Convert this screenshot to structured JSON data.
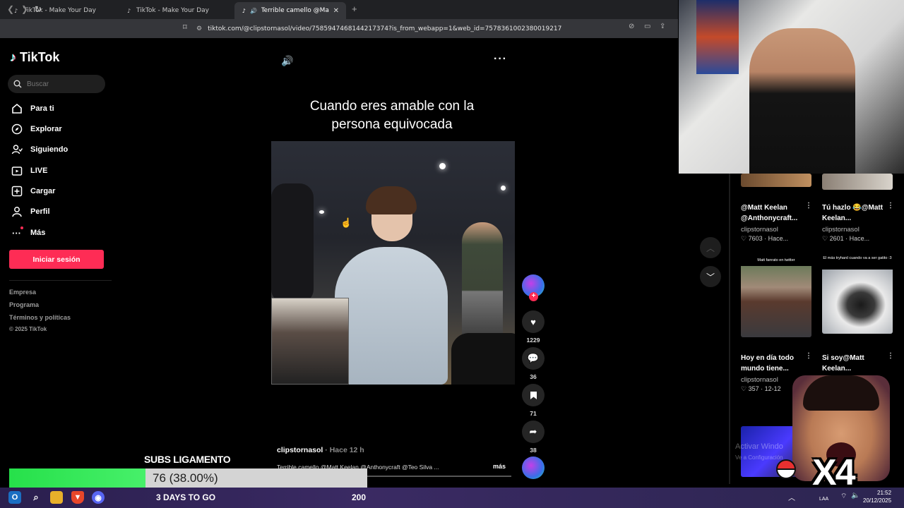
{
  "browser": {
    "tabs": [
      {
        "label": "TikTok - Make Your Day",
        "active": false
      },
      {
        "label": "TikTok - Make Your Day",
        "active": false
      },
      {
        "label": "Terrible camello @Matt Keela",
        "active": true
      }
    ],
    "url": "tiktok.com/@clipstornasol/video/7585947468144217374?is_from_webapp=1&web_id=7578361002380019217"
  },
  "sidebar": {
    "brand": "TikTok",
    "search_placeholder": "Buscar",
    "nav": [
      {
        "label": "Para ti",
        "icon": "home-icon"
      },
      {
        "label": "Explorar",
        "icon": "compass-icon"
      },
      {
        "label": "Siguiendo",
        "icon": "following-icon"
      },
      {
        "label": "LIVE",
        "icon": "live-icon"
      },
      {
        "label": "Cargar",
        "icon": "upload-icon"
      },
      {
        "label": "Perfil",
        "icon": "profile-icon"
      },
      {
        "label": "Más",
        "icon": "more-icon"
      }
    ],
    "login_label": "Iniciar sesión",
    "footer": [
      "Empresa",
      "Programa",
      "Términos y políticas",
      "© 2025 TikTok"
    ]
  },
  "video": {
    "caption_overlay": "Cuando eres amable con la persona equivocada",
    "author": "clipstornasol",
    "posted": "· Hace 12 h",
    "description": "Terrible camello @Matt Keelan @Anthonycraft @Teo Silva ...",
    "more_label": "más",
    "likes": "1229",
    "comments": "36",
    "saves": "71",
    "shares": "38"
  },
  "related": [
    {
      "title": "@Matt Keelan @Anthonycraft...",
      "author": "clipstornasol",
      "likes": "7603",
      "time": "Hace..."
    },
    {
      "title": "Tú hazlo 😂@Matt Keelan...",
      "author": "clipstornasol",
      "likes": "2601",
      "time": "Hace..."
    },
    {
      "title": "Hoy en día todo mundo tiene...",
      "author": "clipstornasol",
      "likes": "357",
      "time": "12-12",
      "thumb_text": "Matt fanrato en twitter"
    },
    {
      "title": "Si soy@Matt Keelan...",
      "author": "",
      "likes": "",
      "time": "",
      "thumb_text": "El más tryhard cuando va a ser gatito :3"
    }
  ],
  "stream_overlay": {
    "subs_title": "SUBS LIGAMENTO",
    "subs_progress_text": "76 (38.00%)",
    "subs_fraction": 0.38,
    "days_left": "3 DAYS TO GO",
    "goal": "200",
    "multiplier": "X4",
    "watermark": "Activar Windo",
    "watermark_sub": "Ve a Configuración"
  },
  "taskbar": {
    "lang": "LAA",
    "time": "21:52",
    "date": "20/12/2025"
  },
  "colors": {
    "accent": "#fe2c55",
    "progress_green": "#3ae85a"
  }
}
